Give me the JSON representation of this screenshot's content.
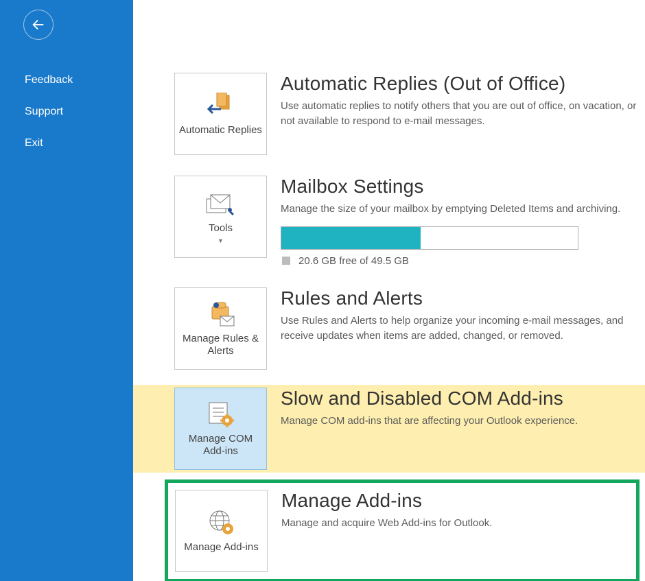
{
  "sidebar": {
    "items": [
      {
        "label": "Feedback"
      },
      {
        "label": "Support"
      },
      {
        "label": "Exit"
      }
    ]
  },
  "tiles": {
    "autoreplies": "Automatic Replies",
    "tools": "Tools",
    "rules": "Manage Rules & Alerts",
    "comaddins": "Manage COM Add-ins",
    "addins": "Manage Add-ins"
  },
  "sections": {
    "auto": {
      "title": "Automatic Replies (Out of Office)",
      "desc": "Use automatic replies to notify others that you are out of office, on vacation, or not available to respond to e-mail messages."
    },
    "mailbox": {
      "title": "Mailbox Settings",
      "desc": "Manage the size of your mailbox by emptying Deleted Items and archiving.",
      "caption": "20.6 GB free of 49.5 GB",
      "fill_pct": 47
    },
    "rules": {
      "title": "Rules and Alerts",
      "desc": "Use Rules and Alerts to help organize your incoming e-mail messages, and receive updates when items are added, changed, or removed."
    },
    "com": {
      "title": "Slow and Disabled COM Add-ins",
      "desc": "Manage COM add-ins that are affecting your Outlook experience."
    },
    "addins": {
      "title": "Manage Add-ins",
      "desc": "Manage and acquire Web Add-ins for Outlook."
    }
  }
}
